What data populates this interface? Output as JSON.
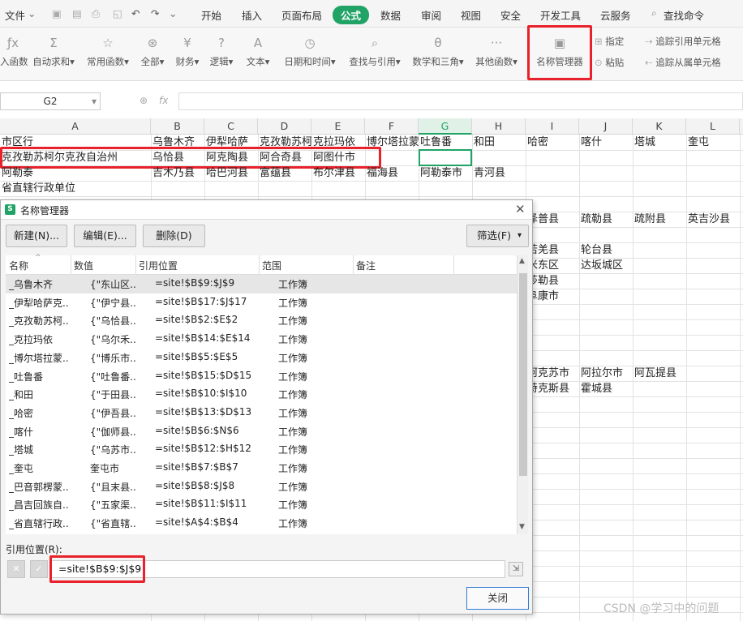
{
  "menubar": {
    "file": "文件",
    "tabs": [
      "开始",
      "插入",
      "页面布局",
      "公式",
      "数据",
      "审阅",
      "视图",
      "安全",
      "开发工具",
      "云服务"
    ],
    "active_tab": "公式",
    "search": "查找命令",
    "accent": "#21a366"
  },
  "ribbon": {
    "insert_fn": "入函数",
    "autosum": "自动求和",
    "common": "常用函数",
    "all": "全部",
    "finance": "财务",
    "logic": "逻辑",
    "text": "文本",
    "datetime": "日期和时间",
    "lookup": "查找与引用",
    "math": "数学和三角",
    "other": "其他函数",
    "name_manager": "名称管理器",
    "define": "指定",
    "paste": "粘贴",
    "trace_prec": "追踪引用单元格",
    "trace_dep": "追踪从属单元格"
  },
  "formula_bar": {
    "name_box": "G2",
    "fx": "fx"
  },
  "columns": [
    "A",
    "B",
    "C",
    "D",
    "E",
    "F",
    "G",
    "H",
    "I",
    "J",
    "K",
    "L"
  ],
  "selected_column": "G",
  "sheet": {
    "row1": [
      "市区行",
      "乌鲁木齐",
      "伊犁哈萨",
      "克孜勒苏柯",
      "克拉玛依",
      "博尔塔拉蒙",
      "吐鲁番",
      "和田",
      "哈密",
      "喀什",
      "塔城",
      "奎屯"
    ],
    "row2": [
      "克孜勒苏柯尔克孜自治州",
      "乌恰县",
      "阿克陶县",
      "阿合奇县",
      "阿图什市"
    ],
    "row3": [
      "阿勒泰",
      "吉木乃县",
      "哈巴河县",
      "富蕴县",
      "布尔津县",
      "福海县",
      "阿勒泰市",
      "青河县"
    ],
    "row4": [
      "省直辖行政单位"
    ],
    "row6": [
      "泽普县",
      "疏勒县",
      "疏附县",
      "英吉沙县"
    ],
    "row7": [
      "若羌县",
      "轮台县"
    ],
    "row8": [
      "米东区",
      "达坂城区"
    ],
    "row9": [
      "莎勒县"
    ],
    "row10": [
      "阜康市"
    ],
    "row14": [
      "阿克苏市",
      "阿拉尔市",
      "阿瓦提县"
    ],
    "row15": [
      "特克斯县",
      "霍城县"
    ]
  },
  "dialog": {
    "title": "名称管理器",
    "new": "新建(N)...",
    "edit": "编辑(E)...",
    "delete": "删除(D)",
    "filter": "筛选(F)",
    "headers": [
      "名称",
      "数值",
      "引用位置",
      "范围",
      "备注"
    ],
    "rows": [
      [
        "_乌鲁木齐",
        "{\"东山区...",
        "=site!$B$9:$J$9",
        "工作簿"
      ],
      [
        "_伊犁哈萨克...",
        "{\"伊宁县...",
        "=site!$B$17:$J$17",
        "工作簿"
      ],
      [
        "_克孜勒苏柯...",
        "{\"乌恰县...",
        "=site!$B$2:$E$2",
        "工作簿"
      ],
      [
        "_克拉玛依",
        "{\"乌尔禾...",
        "=site!$B$14:$E$14",
        "工作簿"
      ],
      [
        "_博尔塔拉蒙...",
        "{\"博乐市...",
        "=site!$B$5:$E$5",
        "工作簿"
      ],
      [
        "_吐鲁番",
        "{\"吐鲁番...",
        "=site!$B$15:$D$15",
        "工作簿"
      ],
      [
        "_和田",
        "{\"于田县...",
        "=site!$B$10:$I$10",
        "工作簿"
      ],
      [
        "_哈密",
        "{\"伊吾县...",
        "=site!$B$13:$D$13",
        "工作簿"
      ],
      [
        "_喀什",
        "{\"伽师县...",
        "=site!$B$6:$N$6",
        "工作簿"
      ],
      [
        "_塔城",
        "{\"乌苏市...",
        "=site!$B$12:$H$12",
        "工作簿"
      ],
      [
        "_奎屯",
        "奎屯市",
        "=site!$B$7:$B$7",
        "工作簿"
      ],
      [
        "_巴音郭楞蒙...",
        "{\"且末县...",
        "=site!$B$8:$J$8",
        "工作簿"
      ],
      [
        "_昌吉回族自...",
        "{\"五家渠...",
        "=site!$B$11:$I$11",
        "工作簿"
      ],
      [
        "_省直辖行政...",
        "{\"省直辖...",
        "=site!$A$4:$B$4",
        "工作簿"
      ]
    ],
    "ref_label": "引用位置(R):",
    "ref_value": "=site!$B$9:$J$9",
    "cancel": "✕",
    "confirm": "✓",
    "close": "关闭"
  },
  "watermark": "CSDN @学习中的问题"
}
